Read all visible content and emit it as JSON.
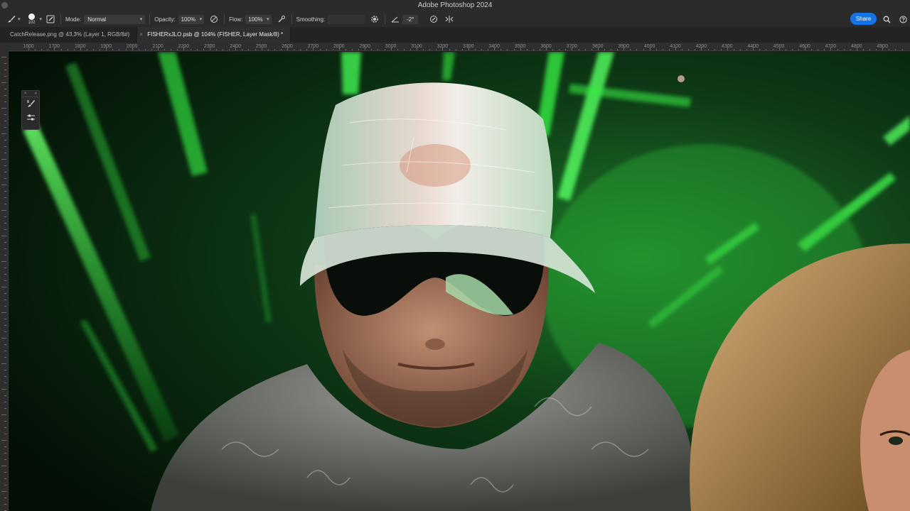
{
  "app": {
    "title": "Adobe Photoshop 2024"
  },
  "options_bar": {
    "brush_size": "102",
    "mode_label": "Mode:",
    "mode_value": "Normal",
    "opacity_label": "Opacity:",
    "opacity_value": "100%",
    "flow_label": "Flow:",
    "flow_value": "100%",
    "smoothing_label": "Smoothing:",
    "angle_value": "-2°",
    "share_label": "Share",
    "icons": [
      "brush-tool-icon",
      "brush-preset-icon",
      "toggle-brush-settings-icon",
      "opacity-pressure-icon",
      "airbrush-icon",
      "smoothing-settings-icon",
      "brush-angle-icon",
      "size-pressure-icon",
      "symmetry-icon",
      "search-icon",
      "help-icon"
    ]
  },
  "tabs": [
    {
      "label": "CatchRelease.png @ 43,3% (Layer 1, RGB/8#)",
      "active": false
    },
    {
      "label": "FISHERxJLO.psb @ 104% (FISHER, Layer Mask/8) *",
      "active": true
    }
  ],
  "ruler": {
    "top_labels": [
      "1600",
      "1700",
      "1800",
      "1900",
      "2000",
      "2100",
      "2200",
      "2300",
      "2400",
      "2500",
      "2600",
      "2700",
      "2800",
      "2900",
      "3000",
      "3100",
      "3200",
      "3300",
      "3400",
      "3500",
      "3600",
      "3700",
      "3800",
      "3900",
      "4000",
      "4100",
      "4200",
      "4300",
      "4400",
      "4500",
      "4600",
      "4700",
      "4800",
      "4900"
    ]
  },
  "mini_panel": {
    "icons": [
      "brush-icon",
      "brush-settings-icon"
    ]
  },
  "colors": {
    "accent": "#1473e6",
    "laser_green": "#3dff4a",
    "background_dark": "#0a1a0d"
  }
}
